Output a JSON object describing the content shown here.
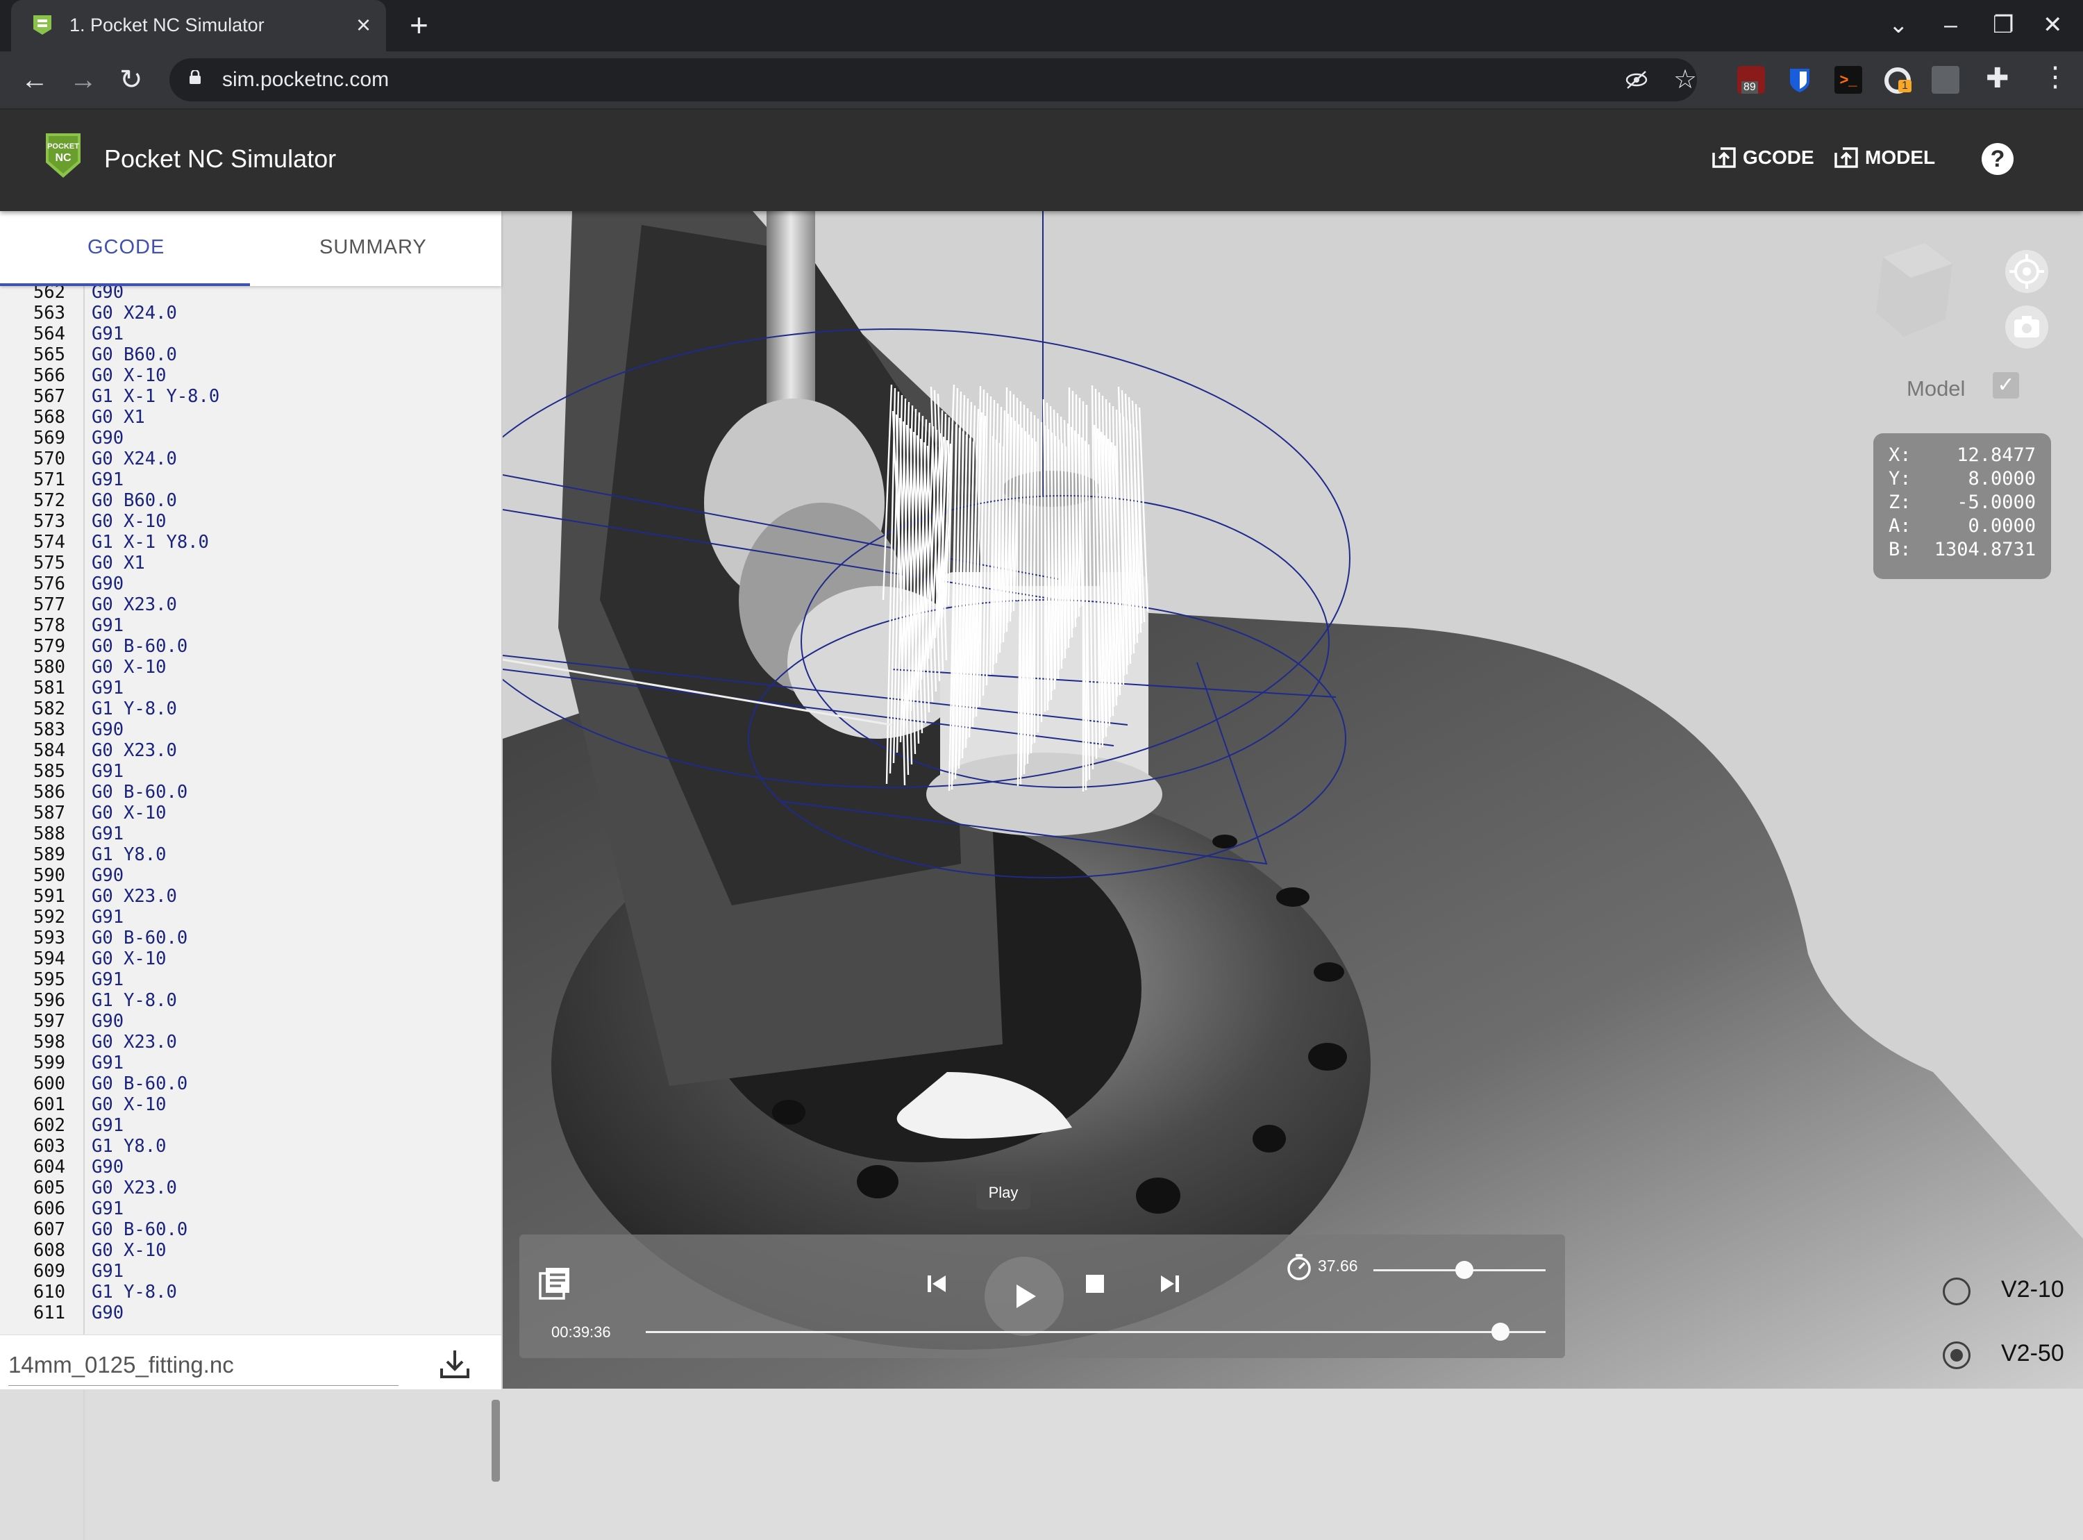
{
  "browser": {
    "tab_title": "1. Pocket NC Simulator",
    "url": "sim.pocketnc.com",
    "extension_badges": [
      "89",
      "1"
    ]
  },
  "app": {
    "title": "Pocket NC Simulator",
    "logo_text": [
      "POCKET",
      "NC"
    ],
    "gcode_button": "GCODE",
    "model_button": "MODEL",
    "help_label": "?"
  },
  "panel": {
    "tab_gcode": "GCODE",
    "tab_summary": "SUMMARY",
    "file_name": "14mm_0125_fitting.nc",
    "lines": [
      {
        "n": "562",
        "code": "G90"
      },
      {
        "n": "563",
        "code": "G0 X24.0"
      },
      {
        "n": "564",
        "code": "G91"
      },
      {
        "n": "565",
        "code": "G0 B60.0"
      },
      {
        "n": "566",
        "code": "G0 X-10"
      },
      {
        "n": "567",
        "code": "G1 X-1 Y-8.0"
      },
      {
        "n": "568",
        "code": "G0 X1"
      },
      {
        "n": "569",
        "code": "G90"
      },
      {
        "n": "570",
        "code": "G0 X24.0"
      },
      {
        "n": "571",
        "code": "G91"
      },
      {
        "n": "572",
        "code": "G0 B60.0"
      },
      {
        "n": "573",
        "code": "G0 X-10"
      },
      {
        "n": "574",
        "code": "G1 X-1 Y8.0"
      },
      {
        "n": "575",
        "code": "G0 X1"
      },
      {
        "n": "576",
        "code": "G90"
      },
      {
        "n": "577",
        "code": "G0 X23.0"
      },
      {
        "n": "578",
        "code": "G91"
      },
      {
        "n": "579",
        "code": "G0 B-60.0"
      },
      {
        "n": "580",
        "code": "G0 X-10"
      },
      {
        "n": "581",
        "code": "G91"
      },
      {
        "n": "582",
        "code": "G1 Y-8.0"
      },
      {
        "n": "583",
        "code": "G90"
      },
      {
        "n": "584",
        "code": "G0 X23.0"
      },
      {
        "n": "585",
        "code": "G91"
      },
      {
        "n": "586",
        "code": "G0 B-60.0"
      },
      {
        "n": "587",
        "code": "G0 X-10"
      },
      {
        "n": "588",
        "code": "G91"
      },
      {
        "n": "589",
        "code": "G1 Y8.0"
      },
      {
        "n": "590",
        "code": "G90"
      },
      {
        "n": "591",
        "code": "G0 X23.0"
      },
      {
        "n": "592",
        "code": "G91"
      },
      {
        "n": "593",
        "code": "G0 B-60.0"
      },
      {
        "n": "594",
        "code": "G0 X-10"
      },
      {
        "n": "595",
        "code": "G91"
      },
      {
        "n": "596",
        "code": "G1 Y-8.0"
      },
      {
        "n": "597",
        "code": "G90"
      },
      {
        "n": "598",
        "code": "G0 X23.0"
      },
      {
        "n": "599",
        "code": "G91"
      },
      {
        "n": "600",
        "code": "G0 B-60.0"
      },
      {
        "n": "601",
        "code": "G0 X-10"
      },
      {
        "n": "602",
        "code": "G91"
      },
      {
        "n": "603",
        "code": "G1 Y8.0"
      },
      {
        "n": "604",
        "code": "G90"
      },
      {
        "n": "605",
        "code": "G0 X23.0"
      },
      {
        "n": "606",
        "code": "G91"
      },
      {
        "n": "607",
        "code": "G0 B-60.0"
      },
      {
        "n": "608",
        "code": "G0 X-10"
      },
      {
        "n": "609",
        "code": "G91"
      },
      {
        "n": "610",
        "code": "G1 Y-8.0"
      },
      {
        "n": "611",
        "code": "G90"
      }
    ]
  },
  "viewport": {
    "model_toggle_label": "Model",
    "model_visible": true,
    "coords": [
      {
        "axis": "X:",
        "value": "12.8477"
      },
      {
        "axis": "Y:",
        "value": "8.0000"
      },
      {
        "axis": "Z:",
        "value": "-5.0000"
      },
      {
        "axis": "A:",
        "value": "0.0000"
      },
      {
        "axis": "B:",
        "value": "1304.8731"
      }
    ],
    "machine_options": [
      {
        "label": "V2-10",
        "selected": false
      },
      {
        "label": "V2-50",
        "selected": true
      }
    ]
  },
  "player": {
    "tooltip": "Play",
    "speed": "37.66",
    "speed_fraction": 0.53,
    "elapsed": "00:39:36",
    "progress_fraction": 0.95
  },
  "colors": {
    "accent": "#3f51b5",
    "code_text": "#1a237e",
    "header_bg": "#2f2f2f",
    "browser_bg": "#202124"
  }
}
